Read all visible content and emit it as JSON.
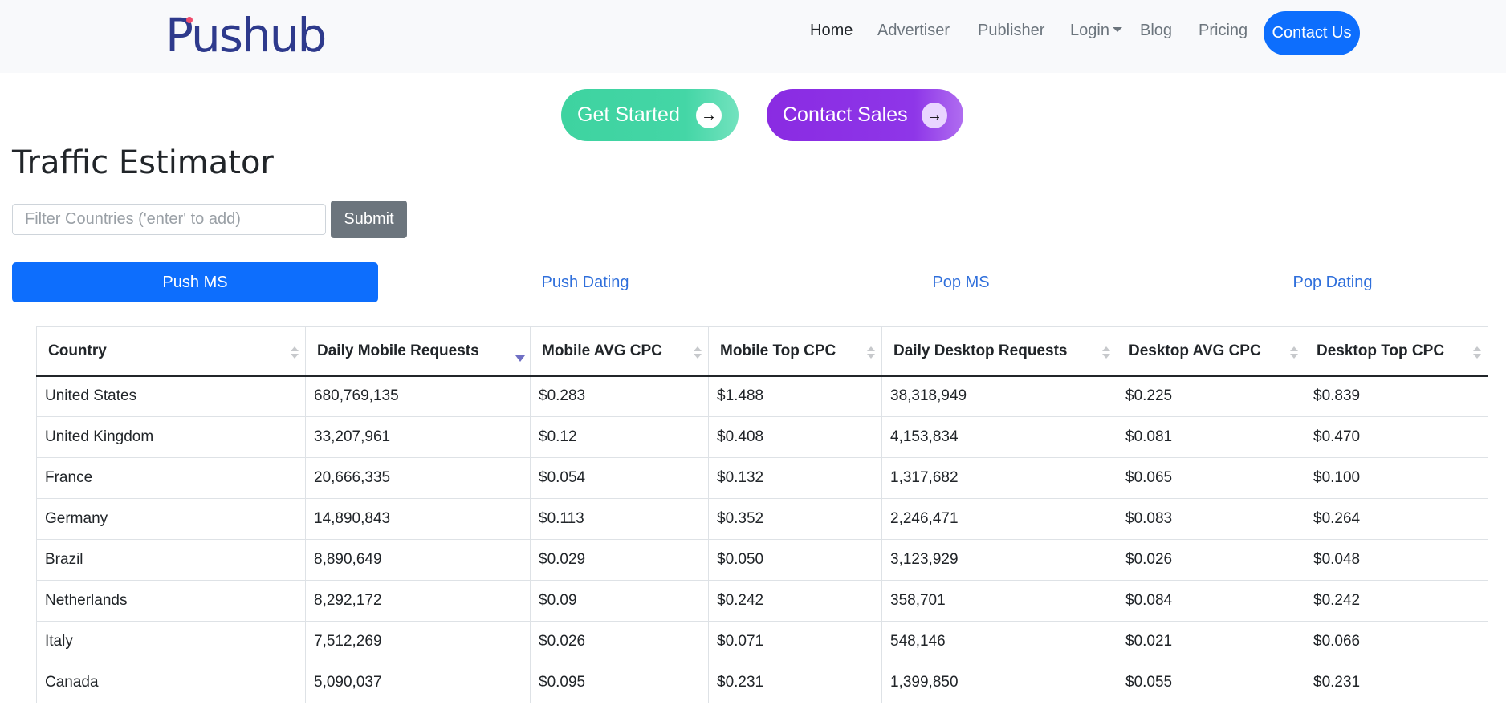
{
  "brand": {
    "logo_text": "Pushub"
  },
  "nav": {
    "home": "Home",
    "advertiser": "Advertiser",
    "publisher": "Publisher",
    "login": "Login",
    "blog": "Blog",
    "pricing": "Pricing",
    "contact": "Contact Us"
  },
  "cta": {
    "get_started": "Get Started",
    "contact_sales": "Contact Sales",
    "arrow": "→"
  },
  "page_title": "Traffic Estimator",
  "filter": {
    "placeholder": "Filter Countries ('enter' to add)",
    "value": "",
    "submit": "Submit"
  },
  "tabs": [
    "Push MS",
    "Push Dating",
    "Pop MS",
    "Pop Dating"
  ],
  "active_tab": "Push MS",
  "table": {
    "headers": [
      "Country",
      "Daily Mobile Requests",
      "Mobile AVG CPC",
      "Mobile Top CPC",
      "Daily Desktop Requests",
      "Desktop AVG CPC",
      "Desktop Top CPC"
    ],
    "sorted_column": "Daily Mobile Requests",
    "sort_direction": "desc",
    "rows": [
      [
        "United States",
        "680,769,135",
        "$0.283",
        "$1.488",
        "38,318,949",
        "$0.225",
        "$0.839"
      ],
      [
        "United Kingdom",
        "33,207,961",
        "$0.12",
        "$0.408",
        "4,153,834",
        "$0.081",
        "$0.470"
      ],
      [
        "France",
        "20,666,335",
        "$0.054",
        "$0.132",
        "1,317,682",
        "$0.065",
        "$0.100"
      ],
      [
        "Germany",
        "14,890,843",
        "$0.113",
        "$0.352",
        "2,246,471",
        "$0.083",
        "$0.264"
      ],
      [
        "Brazil",
        "8,890,649",
        "$0.029",
        "$0.050",
        "3,123,929",
        "$0.026",
        "$0.048"
      ],
      [
        "Netherlands",
        "8,292,172",
        "$0.09",
        "$0.242",
        "358,701",
        "$0.084",
        "$0.242"
      ],
      [
        "Italy",
        "7,512,269",
        "$0.026",
        "$0.071",
        "548,146",
        "$0.021",
        "$0.066"
      ],
      [
        "Canada",
        "5,090,037",
        "$0.095",
        "$0.231",
        "1,399,850",
        "$0.055",
        "$0.231"
      ]
    ]
  },
  "colors": {
    "primary": "#0d6efd",
    "brand": "#2e3a8c",
    "get_started": "#44d6a6",
    "contact_sales": "#8a2be2",
    "submit": "#6c757d"
  }
}
